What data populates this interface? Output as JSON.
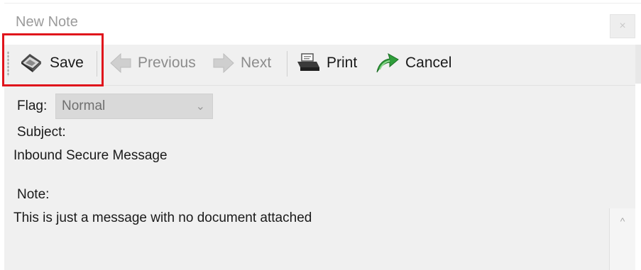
{
  "window": {
    "title": "New Note",
    "close_glyph": "×"
  },
  "toolbar": {
    "save_label": "Save",
    "previous_label": "Previous",
    "next_label": "Next",
    "print_label": "Print",
    "cancel_label": "Cancel",
    "icons": [
      "save-icon",
      "previous-arrow-icon",
      "next-arrow-icon",
      "printer-icon",
      "cancel-arrow-icon"
    ]
  },
  "form": {
    "flag_label": "Flag:",
    "flag_value": "Normal",
    "subject_label": "Subject:",
    "subject_value": "Inbound Secure Message",
    "note_label": "Note:",
    "note_value": "This is just a message with no document attached"
  },
  "colors": {
    "highlight": "#e0141c",
    "panel_bg": "#f0f0f0",
    "cancel_icon": "#2f9e3a"
  }
}
